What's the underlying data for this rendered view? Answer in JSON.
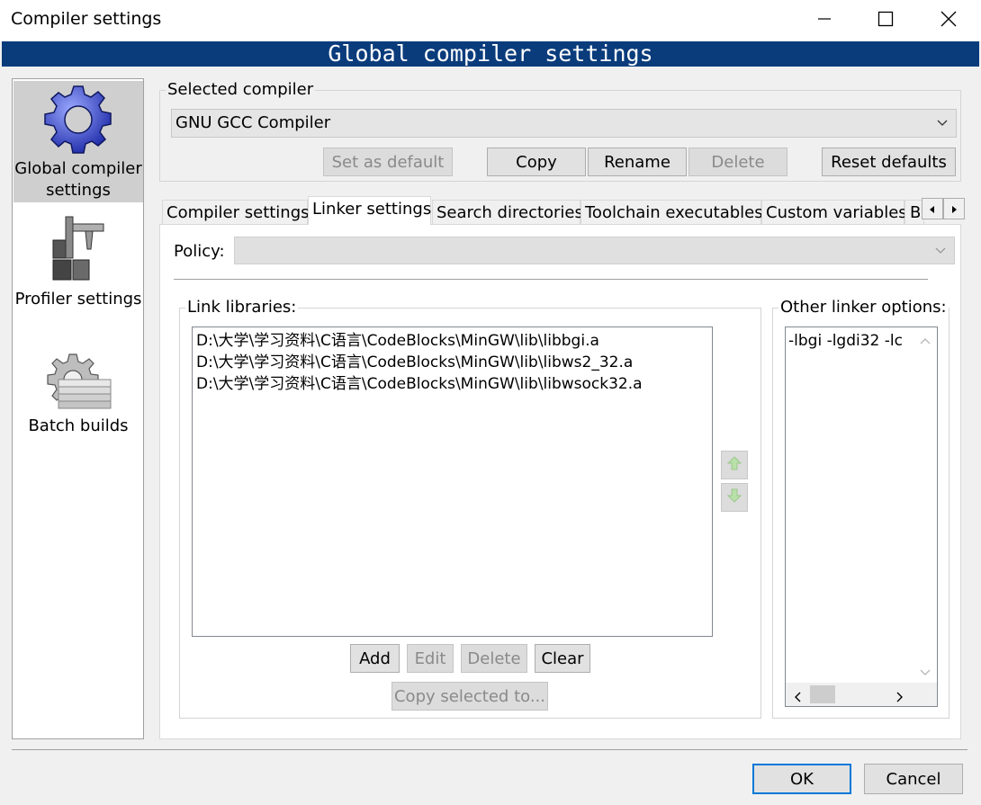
{
  "window": {
    "title": "Compiler settings",
    "controls": [
      "minimize-icon",
      "maximize-icon",
      "close-icon"
    ]
  },
  "banner": {
    "title": "Global compiler settings"
  },
  "sidebar": {
    "items": [
      {
        "label_line1": "Global compiler",
        "label_line2": "settings",
        "icon": "gear-icon",
        "selected": true
      },
      {
        "label": "Profiler settings",
        "icon": "profiler-icon",
        "selected": false
      },
      {
        "label": "Batch builds",
        "icon": "batch-builds-icon",
        "selected": false
      }
    ]
  },
  "selected_compiler": {
    "group_label": "Selected compiler",
    "value": "GNU GCC Compiler",
    "buttons": {
      "set_default": "Set as default",
      "copy": "Copy",
      "rename": "Rename",
      "delete": "Delete",
      "reset_defaults": "Reset defaults"
    }
  },
  "tabs": {
    "items": [
      "Compiler settings",
      "Linker settings",
      "Search directories",
      "Toolchain executables",
      "Custom variables",
      "B"
    ],
    "active": "Linker settings"
  },
  "policy": {
    "label": "Policy:",
    "value": ""
  },
  "link_libraries": {
    "label": "Link libraries:",
    "items": [
      "D:\\大学\\学习资料\\C语言\\CodeBlocks\\MinGW\\lib\\libbgi.a",
      "D:\\大学\\学习资料\\C语言\\CodeBlocks\\MinGW\\lib\\libws2_32.a",
      "D:\\大学\\学习资料\\C语言\\CodeBlocks\\MinGW\\lib\\libwsock32.a"
    ],
    "buttons": {
      "add": "Add",
      "edit": "Edit",
      "delete": "Delete",
      "clear": "Clear",
      "copy_selected": "Copy selected to..."
    }
  },
  "other_linker_options": {
    "label": "Other linker options:",
    "value": "-lbgi -lgdi32 -lc"
  },
  "footer": {
    "ok": "OK",
    "cancel": "Cancel"
  },
  "colors": {
    "banner": "#0a3c7c",
    "selected_item": "#cfcfcf",
    "ok_border": "#0078d7"
  }
}
